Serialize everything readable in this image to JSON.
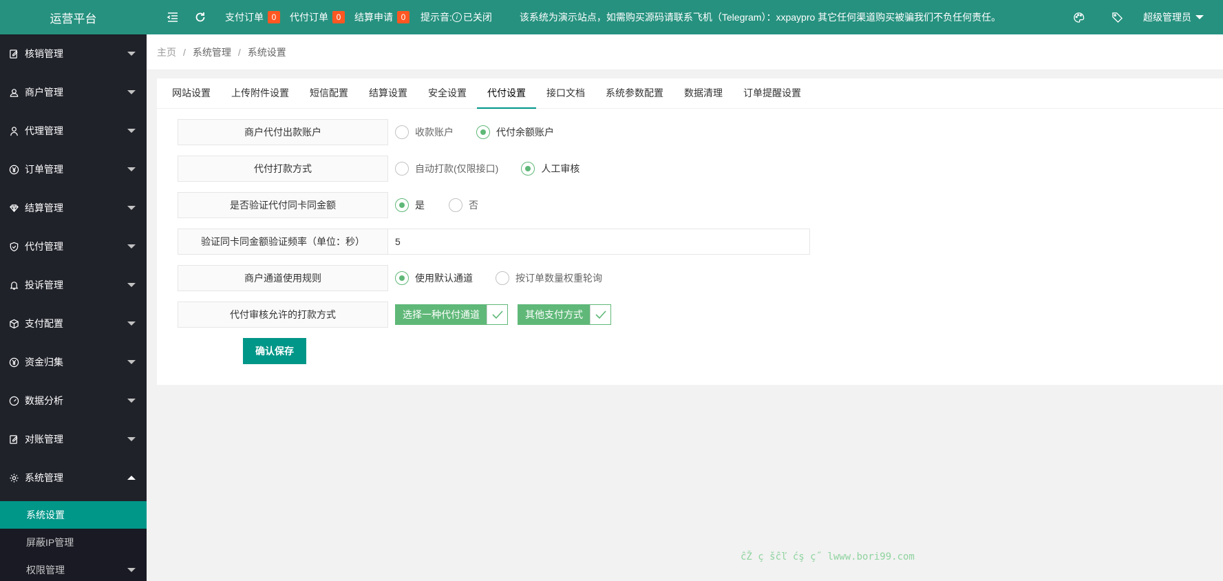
{
  "sidebar": {
    "logo": "运营平台",
    "items": [
      {
        "label": "核销管理",
        "icon": "edit-icon"
      },
      {
        "label": "商户管理",
        "icon": "user-icon"
      },
      {
        "label": "代理管理",
        "icon": "person-icon"
      },
      {
        "label": "订单管理",
        "icon": "yen-icon"
      },
      {
        "label": "结算管理",
        "icon": "diamond-icon"
      },
      {
        "label": "代付管理",
        "icon": "shield-icon"
      },
      {
        "label": "投诉管理",
        "icon": "bell-icon"
      },
      {
        "label": "支付配置",
        "icon": "cube-icon"
      },
      {
        "label": "资金归集",
        "icon": "yen-icon"
      },
      {
        "label": "数据分析",
        "icon": "gauge-icon"
      },
      {
        "label": "对账管理",
        "icon": "edit-icon"
      },
      {
        "label": "系统管理",
        "icon": "gear-icon"
      }
    ],
    "subitems": [
      {
        "label": "系统设置"
      },
      {
        "label": "屏蔽IP管理"
      },
      {
        "label": "权限管理"
      }
    ]
  },
  "header": {
    "pay_order_label": "支付订单",
    "pay_order_count": "0",
    "df_order_label": "代付订单",
    "df_order_count": "0",
    "settle_label": "结算申请",
    "settle_count": "0",
    "tip_sound_label": "提示音:",
    "tip_sound_status": "已关闭",
    "notice": "该系统为演示站点，如需购买源码请联系飞机（Telegram）：xxpaypro 其它任何渠道购买被骗我们不负任何责任。",
    "admin": "超级管理员"
  },
  "breadcrumb": {
    "home": "主页",
    "parent": "系统管理",
    "current": "系统设置"
  },
  "tabs": [
    {
      "label": "网站设置"
    },
    {
      "label": "上传附件设置"
    },
    {
      "label": "短信配置"
    },
    {
      "label": "结算设置"
    },
    {
      "label": "安全设置"
    },
    {
      "label": "代付设置"
    },
    {
      "label": "接口文档"
    },
    {
      "label": "系统参数配置"
    },
    {
      "label": "数据清理"
    },
    {
      "label": "订单提醒设置"
    }
  ],
  "active_tab": "代付设置",
  "form": {
    "account": {
      "label": "商户代付出款账户",
      "options": [
        "收款账户",
        "代付余额账户"
      ],
      "selected": "代付余额账户"
    },
    "pay_method": {
      "label": "代付打款方式",
      "options": [
        "自动打款(仅限接口)",
        "人工审核"
      ],
      "selected": "人工审核"
    },
    "verify_same": {
      "label": "是否验证代付同卡同金额",
      "options": [
        "是",
        "否"
      ],
      "selected": "是"
    },
    "verify_freq": {
      "label": "验证同卡同金额验证频率（单位：秒）",
      "value": "5"
    },
    "channel_rule": {
      "label": "商户通道使用规则",
      "options": [
        "使用默认通道",
        "按订单数量权重轮询"
      ],
      "selected": "使用默认通道"
    },
    "allowed_methods": {
      "label": "代付审核允许的打款方式",
      "options": [
        "选择一种代付通道",
        "其他支付方式"
      ],
      "checked": [
        "选择一种代付通道",
        "其他支付方式"
      ]
    },
    "save_label": "确认保存"
  },
  "watermark": "ĉŽ ç šĉľ ćş ç˝ lwww.bori99.com",
  "colors": {
    "header_bg": "#26917f",
    "sidebar_bg": "#20222a",
    "active_green": "#009688",
    "radio_green": "#5FB878",
    "badge": "#ff5722"
  }
}
